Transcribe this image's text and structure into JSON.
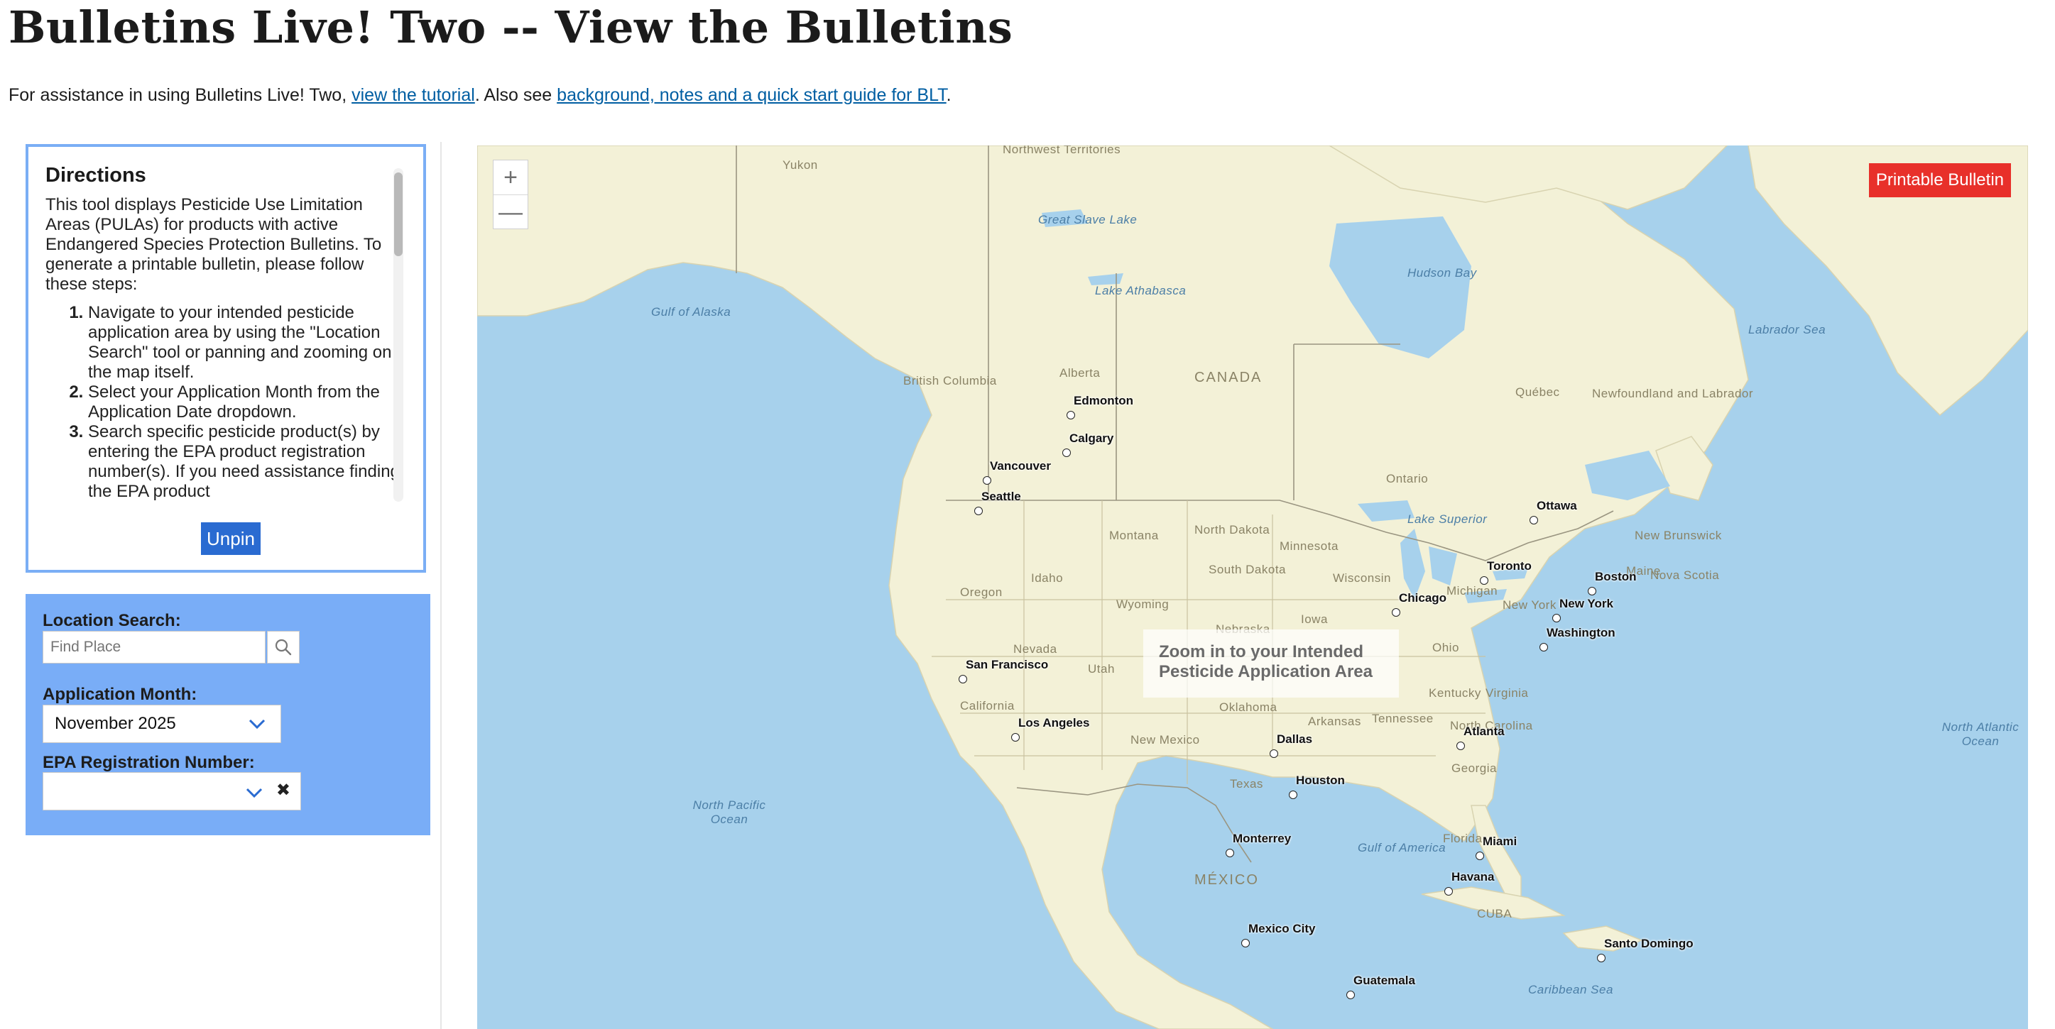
{
  "page": {
    "title": "Bulletins Live! Two -- View the Bulletins",
    "intro_prefix": "For assistance in using Bulletins Live! Two, ",
    "intro_link1": "view the tutorial",
    "intro_middle": ". Also see ",
    "intro_link2": "background, notes and a quick start guide for BLT",
    "intro_suffix": "."
  },
  "directions": {
    "title": "Directions",
    "body": "This tool displays Pesticide Use Limitation Areas (PULAs) for products with active Endangered Species Protection Bulletins. To generate a printable bulletin, please follow these steps:",
    "steps": [
      "Navigate to your intended pesticide application area by using the \"Location Search\" tool or panning and zooming on the map itself.",
      "Select your Application Month from the Application Date dropdown.",
      "Search specific pesticide product(s) by entering the EPA product registration number(s). If you need assistance finding the EPA product"
    ],
    "unpin_label": "Unpin"
  },
  "search": {
    "location_label": "Location Search:",
    "location_placeholder": "Find Place",
    "month_label": "Application Month:",
    "month_value": "November 2025",
    "epa_label": "EPA Registration Number:",
    "epa_value": "",
    "clear_glyph": "✖"
  },
  "map": {
    "printable_label": "Printable Bulletin",
    "zoom_in": "+",
    "zoom_out": "—",
    "zoom_note": "Zoom in to your Intended Pesticide Application Area",
    "land_color": "#f3f1d7",
    "water_color": "#a7d1ec",
    "cities": [
      "Edmonton",
      "Calgary",
      "Vancouver",
      "Seattle",
      "Ottawa",
      "Toronto",
      "Boston",
      "Chicago",
      "New York",
      "Washington",
      "San Francisco",
      "Los Angeles",
      "Dallas",
      "Atlanta",
      "Houston",
      "Monterrey",
      "Miami",
      "Havana",
      "Mexico City",
      "Santo Domingo",
      "Guatemala"
    ],
    "regions": [
      "Yukon",
      "Northwest Territories",
      "Great Slave Lake",
      "Lake Athabasca",
      "Hudson Bay",
      "Gulf of Alaska",
      "Labrador Sea",
      "Alberta",
      "British Columbia",
      "CANADA",
      "Québec",
      "Newfoundland and Labrador",
      "Ontario",
      "Lake Superior",
      "New Brunswick",
      "Nova Scotia",
      "Maine",
      "Montana",
      "North Dakota",
      "Minnesota",
      "Idaho",
      "South Dakota",
      "Wisconsin",
      "Oregon",
      "Wyoming",
      "Nebraska",
      "Iowa",
      "Michigan",
      "New York",
      "Nevada",
      "Utah",
      "Ohio",
      "Kentucky",
      "Virginia",
      "California",
      "Oklahoma",
      "Arkansas",
      "Tennessee",
      "North Carolina",
      "New Mexico",
      "Georgia",
      "Texas",
      "North Pacific Ocean",
      "Florida",
      "Gulf of America",
      "North Atlantic Ocean",
      "MÉXICO",
      "CUBA",
      "Caribbean Sea"
    ]
  }
}
